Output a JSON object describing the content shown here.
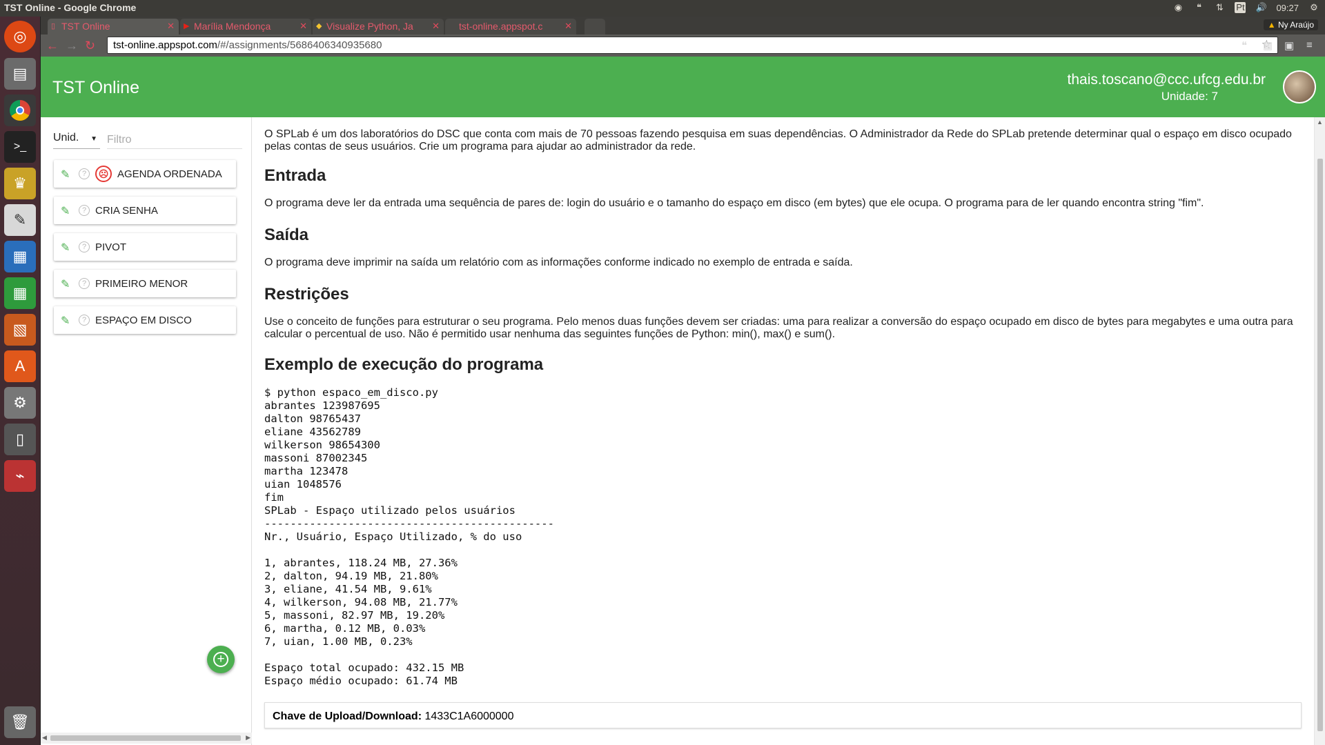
{
  "os": {
    "window_title": "TST Online - Google Chrome",
    "lang": "Pt",
    "time": "09:27"
  },
  "browser": {
    "tabs": [
      {
        "label": "TST Online"
      },
      {
        "label": "Marília Mendonça"
      },
      {
        "label": "Visualize Python, Ja"
      },
      {
        "label": "tst-online.appspot.c"
      }
    ],
    "profile": "Ny Araújo",
    "url_host": "tst-online.appspot.com",
    "url_path": "/#/assignments/5686406340935680"
  },
  "header": {
    "title": "TST Online",
    "email": "thais.toscano@ccc.ufcg.edu.br",
    "unit": "Unidade: 7"
  },
  "sidebar": {
    "unit_select": "Unid.",
    "filter_placeholder": "Filtro",
    "items": [
      {
        "label": "AGENDA ORDENADA"
      },
      {
        "label": "CRIA SENHA"
      },
      {
        "label": "PIVOT"
      },
      {
        "label": "PRIMEIRO MENOR"
      },
      {
        "label": "ESPAÇO EM DISCO"
      }
    ]
  },
  "content": {
    "intro": "O SPLab é um dos laboratórios do DSC que conta com mais de 70 pessoas fazendo pesquisa em suas dependências. O Administrador da Rede do SPLab pretende determinar qual o espaço em disco ocupado pelas contas de seus usuários. Crie um programa para ajudar ao administrador da rede.",
    "entrada_title": "Entrada",
    "entrada_text": "O programa deve ler da entrada uma sequência de pares de: login do usuário e o tamanho do espaço em disco (em bytes) que ele ocupa. O programa para de ler quando encontra string \"fim\".",
    "saida_title": "Saída",
    "saida_text": "O programa deve imprimir na saída um relatório com as informações conforme indicado no exemplo de entrada e saída.",
    "restricoes_title": "Restrições",
    "restricoes_text": "Use o conceito de funções para estruturar o seu programa. Pelo menos duas funções devem ser criadas: uma para realizar a conversão do espaço ocupado em disco de bytes para megabytes e uma outra para calcular o percentual de uso. Não é permitido usar nenhuma das seguintes funções de Python: min(), max() e sum().",
    "exemplo_title": "Exemplo de execução do programa",
    "exemplo_code": "$ python espaco_em_disco.py\nabrantes 123987695\ndalton 98765437\neliane 43562789\nwilkerson 98654300\nmassoni 87002345\nmartha 123478\nuian 1048576\nfim\nSPLab - Espaço utilizado pelos usuários\n---------------------------------------------\nNr., Usuário, Espaço Utilizado, % do uso\n\n1, abrantes, 118.24 MB, 27.36%\n2, dalton, 94.19 MB, 21.80%\n3, eliane, 41.54 MB, 9.61%\n4, wilkerson, 94.08 MB, 21.77%\n5, massoni, 82.97 MB, 19.20%\n6, martha, 0.12 MB, 0.03%\n7, uian, 1.00 MB, 0.23%\n\nEspaço total ocupado: 432.15 MB\nEspaço médio ocupado: 61.74 MB",
    "upload_label": "Chave de Upload/Download:",
    "upload_key": "1433C1A6000000"
  },
  "colors": {
    "header_green": "#4caf50",
    "error_red": "#e53935"
  }
}
